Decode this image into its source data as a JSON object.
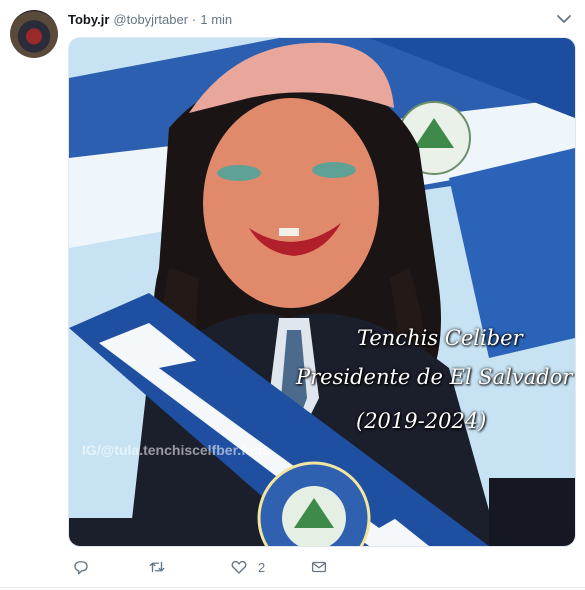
{
  "tweet": {
    "author_name": "Toby.jr",
    "author_handle": "@tobyjrtaber",
    "separator": "·",
    "timestamp": "1 min",
    "image_caption": {
      "line1": "Tenchis Celiber",
      "line2": "Presidente de El Salvador",
      "line3": "(2019-2024)"
    },
    "watermark": "IG/@tula.tenchiscelfber.fans",
    "actions": {
      "reply_icon": "reply-icon",
      "retweet_icon": "retweet-icon",
      "like_icon": "heart-icon",
      "like_count": "2",
      "dm_icon": "envelope-icon"
    }
  },
  "colors": {
    "secondary_text": "#657786",
    "flag_blue": "#1f4fa0",
    "flag_white": "#ffffff"
  }
}
